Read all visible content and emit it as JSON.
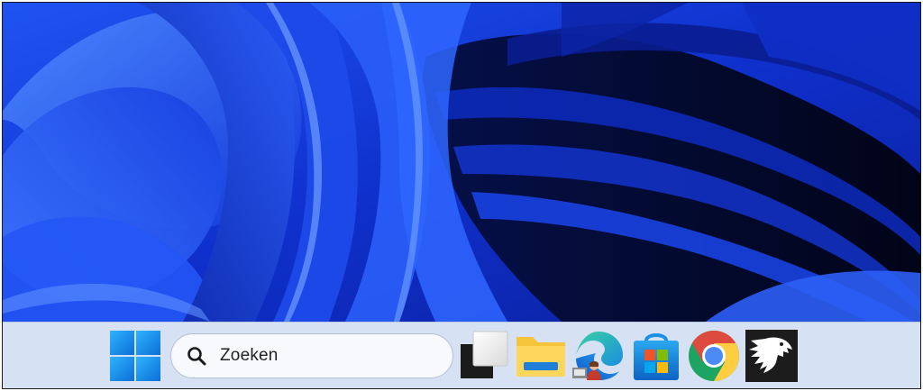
{
  "desktop": {
    "wallpaper_name": "windows-11-bloom-wallpaper",
    "colors": {
      "deep": "#020a3a",
      "dark": "#0b23b5",
      "mid": "#1a4cf0",
      "light": "#4f86ff"
    }
  },
  "taskbar": {
    "background": "#d6e2f4",
    "search": {
      "placeholder": "Zoeken",
      "icon": "search-icon"
    },
    "items": [
      {
        "name": "start-button",
        "icon": "windows-logo-icon"
      },
      {
        "name": "task-view-button",
        "icon": "task-view-icon"
      },
      {
        "name": "file-explorer-button",
        "icon": "folder-icon"
      },
      {
        "name": "edge-button",
        "icon": "edge-icon"
      },
      {
        "name": "microsoft-store-button",
        "icon": "store-icon"
      },
      {
        "name": "chrome-button",
        "icon": "chrome-icon"
      },
      {
        "name": "hawk-app-button",
        "icon": "hawk-icon"
      }
    ]
  }
}
